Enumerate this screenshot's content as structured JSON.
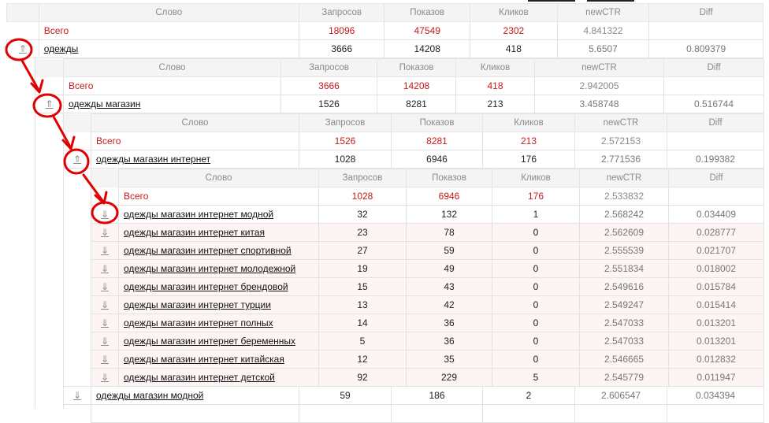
{
  "headers": {
    "word": "Слово",
    "queries": "Запросов",
    "shows": "Показов",
    "clicks": "Кликов",
    "ctr": "newCTR",
    "diff": "Diff"
  },
  "arrows": {
    "up": "⇑",
    "down": "⇓"
  },
  "level1": {
    "total": {
      "label": "Всего",
      "queries": "18096",
      "shows": "47549",
      "clicks": "2302",
      "ctr": "4.841322",
      "diff": ""
    },
    "row": {
      "label": "одежды",
      "queries": "3666",
      "shows": "14208",
      "clicks": "418",
      "ctr": "5.6507",
      "diff": "0.809379"
    }
  },
  "level2": {
    "total": {
      "label": "Всего",
      "queries": "3666",
      "shows": "14208",
      "clicks": "418",
      "ctr": "2.942005",
      "diff": ""
    },
    "row": {
      "label": "одежды магазин",
      "queries": "1526",
      "shows": "8281",
      "clicks": "213",
      "ctr": "3.458748",
      "diff": "0.516744"
    }
  },
  "level3": {
    "total": {
      "label": "Всего",
      "queries": "1526",
      "shows": "8281",
      "clicks": "213",
      "ctr": "2.572153",
      "diff": ""
    },
    "row": {
      "label": "одежды магазин интернет",
      "queries": "1028",
      "shows": "6946",
      "clicks": "176",
      "ctr": "2.771536",
      "diff": "0.199382"
    }
  },
  "level4": {
    "total": {
      "label": "Всего",
      "queries": "1028",
      "shows": "6946",
      "clicks": "176",
      "ctr": "2.533832",
      "diff": ""
    },
    "rows": [
      {
        "label": "одежды магазин интернет модной",
        "queries": "32",
        "shows": "132",
        "clicks": "1",
        "ctr": "2.568242",
        "diff": "0.034409"
      },
      {
        "label": "одежды магазин интернет китая",
        "queries": "23",
        "shows": "78",
        "clicks": "0",
        "ctr": "2.562609",
        "diff": "0.028777"
      },
      {
        "label": "одежды магазин интернет спортивной",
        "queries": "27",
        "shows": "59",
        "clicks": "0",
        "ctr": "2.555539",
        "diff": "0.021707"
      },
      {
        "label": "одежды магазин интернет молодежной",
        "queries": "19",
        "shows": "49",
        "clicks": "0",
        "ctr": "2.551834",
        "diff": "0.018002"
      },
      {
        "label": "одежды магазин интернет брендовой",
        "queries": "15",
        "shows": "43",
        "clicks": "0",
        "ctr": "2.549616",
        "diff": "0.015784"
      },
      {
        "label": "одежды магазин интернет турции",
        "queries": "13",
        "shows": "42",
        "clicks": "0",
        "ctr": "2.549247",
        "diff": "0.015414"
      },
      {
        "label": "одежды магазин интернет полных",
        "queries": "14",
        "shows": "36",
        "clicks": "0",
        "ctr": "2.547033",
        "diff": "0.013201"
      },
      {
        "label": "одежды магазин интернет беременных",
        "queries": "5",
        "shows": "36",
        "clicks": "0",
        "ctr": "2.547033",
        "diff": "0.013201"
      },
      {
        "label": "одежды магазин интернет китайская",
        "queries": "12",
        "shows": "35",
        "clicks": "0",
        "ctr": "2.546665",
        "diff": "0.012832"
      },
      {
        "label": "одежды магазин интернет детской",
        "queries": "92",
        "shows": "229",
        "clicks": "5",
        "ctr": "2.545779",
        "diff": "0.011947"
      }
    ]
  },
  "level3_after": {
    "label": "одежды магазин модной",
    "queries": "59",
    "shows": "186",
    "clicks": "2",
    "ctr": "2.606547",
    "diff": "0.034394"
  },
  "colors": {
    "total_red": "#c81818",
    "annotation_red": "#e00000",
    "pink_row": "#fdf4f4",
    "header_bg": "#f4f4f4"
  }
}
